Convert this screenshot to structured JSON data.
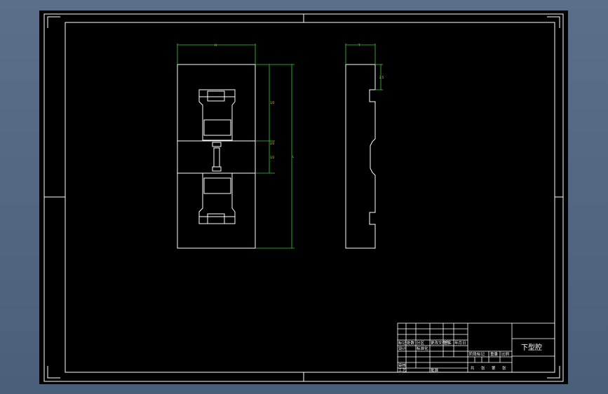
{
  "colors": {
    "background": "#4a5f7a",
    "sheet": "#000000",
    "geometry": "#ffffff",
    "dimension_lines": "#3cc83c",
    "dimension_text": "#e8c84a"
  },
  "drawing": {
    "title": "下型腔",
    "front_view": {
      "width_dim": "H",
      "height_dim": "L",
      "upper_dim": "1/2",
      "mid_dim": "2/2",
      "lower_dim": "1/2"
    },
    "side_view": {
      "width_dim": "T",
      "depth_dim": "2.5"
    }
  },
  "title_block": {
    "row_labels": [
      "标记",
      "处数",
      "分区",
      "更改文件号",
      "签名",
      "年月日"
    ],
    "design_labels": [
      "设计",
      "标准化",
      "审核",
      "工艺",
      "批准"
    ],
    "stage_labels": [
      "阶段标记",
      "重量",
      "比例"
    ],
    "sheet_labels": [
      "共",
      "张",
      "第",
      "张"
    ]
  }
}
